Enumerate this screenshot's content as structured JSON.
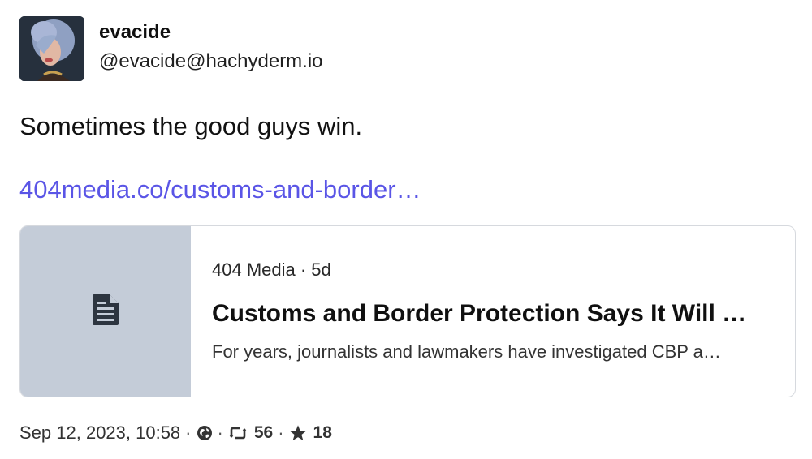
{
  "author": {
    "display_name": "evacide",
    "handle": "@evacide@hachyderm.io",
    "avatar_icon": "user-avatar"
  },
  "post": {
    "text": "Sometimes the good guys win.",
    "link_text": "404media.co/customs-and-border…"
  },
  "preview_card": {
    "meta": "404 Media · 5d",
    "title": "Customs and Border Protection Says It Will …",
    "description": "For years, journalists and lawmakers have investigated CBP a…",
    "thumbnail_icon": "document-icon",
    "thumbnail_color": "#c4ccd8"
  },
  "footer": {
    "timestamp": "Sep 12, 2023, 10:58",
    "visibility_icon": "globe-icon",
    "boost_icon": "boost-icon",
    "boost_count": "56",
    "favourite_icon": "star-icon",
    "favourite_count": "18",
    "separator": "·"
  },
  "colors": {
    "link": "#5a55e6",
    "text": "#101010",
    "card_border": "#d6d9de"
  }
}
